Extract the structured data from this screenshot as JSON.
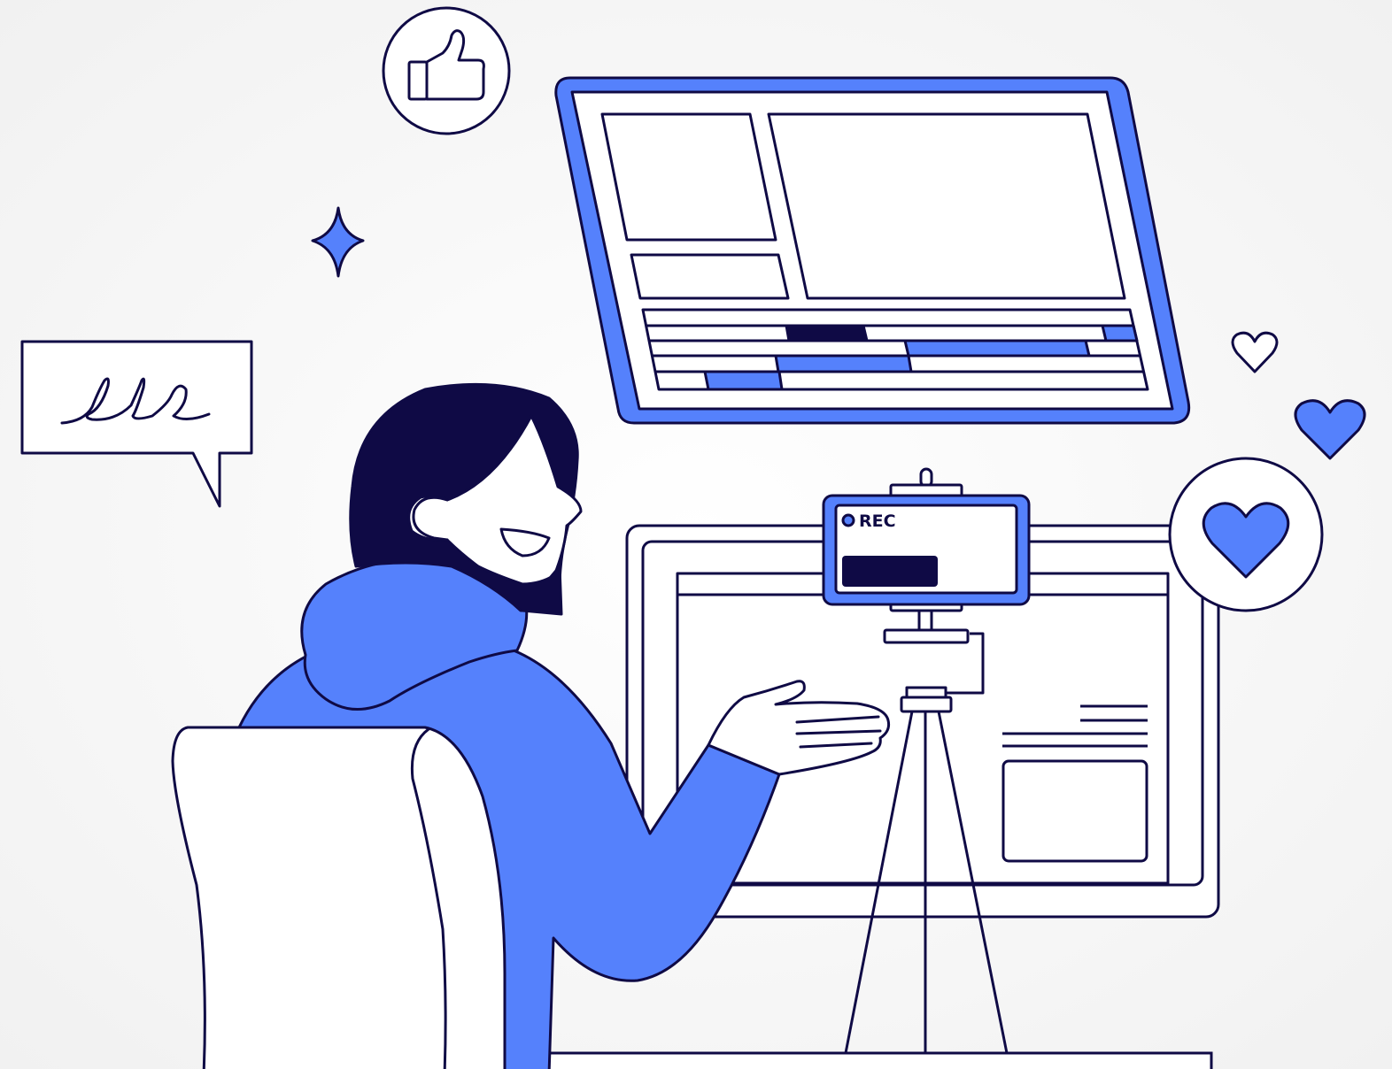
{
  "camera": {
    "rec_label": "REC"
  },
  "colors": {
    "ink": "#0f0a45",
    "accent": "#5581fc",
    "paper": "#ffffff",
    "background": "#fbfbfb"
  },
  "icons": [
    "thumbs-up-icon",
    "sparkle-icon",
    "heart-outline-icon",
    "heart-filled-icon",
    "heart-badge-icon",
    "speech-bubble-icon"
  ]
}
